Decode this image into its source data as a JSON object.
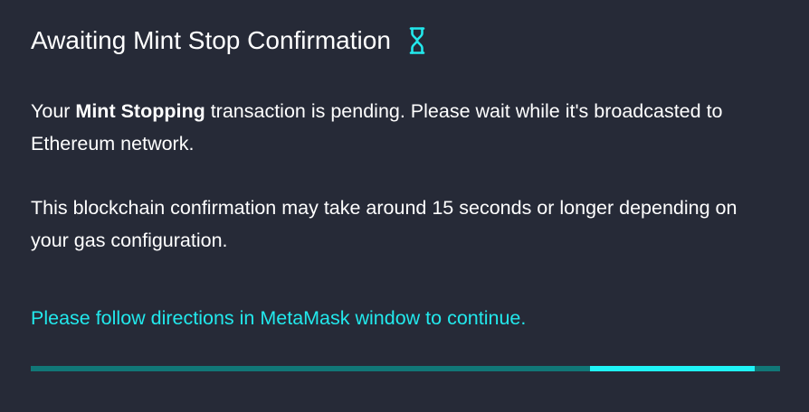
{
  "dialog": {
    "title": "Awaiting Mint Stop Confirmation",
    "title_icon": "hourglass-icon",
    "paragraph1": {
      "prefix": "Your ",
      "bold": "Mint Stopping",
      "suffix": " transaction is pending. Please wait while it's broadcasted to Ethereum network."
    },
    "paragraph2": "This blockchain confirmation may take around 15 seconds or longer depending on your gas configuration.",
    "notice": "Please follow directions in MetaMask window to continue.",
    "progress": {
      "state": "indeterminate",
      "segment_start_fraction": 0.746,
      "segment_end_fraction": 0.966
    }
  },
  "colors": {
    "background": "#262a37",
    "text": "#ffffff",
    "accent": "#22e8ec",
    "progress_track": "#117777",
    "progress_fill": "#1ff3f6"
  }
}
